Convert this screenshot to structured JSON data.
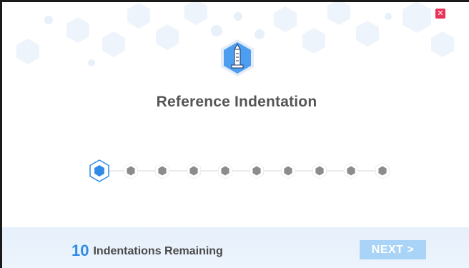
{
  "dialog": {
    "close_label": "✕",
    "title": "Reference Indentation"
  },
  "steps": {
    "total": 10,
    "current": 1
  },
  "footer": {
    "remaining_count": "10",
    "remaining_label": "Indentations Remaining",
    "next_label": "NEXT >"
  },
  "colors": {
    "accent": "#2f8be6",
    "inactive_step": "#8c8c8c",
    "close": "#e8345a",
    "next_button": "#a9d4f7",
    "footer_bg": "#e6f0fb"
  }
}
